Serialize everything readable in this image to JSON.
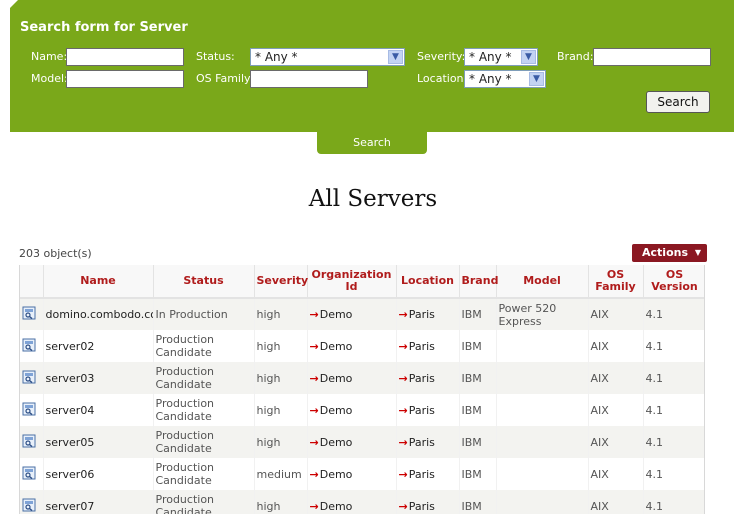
{
  "search_form": {
    "title": "Search form for Server",
    "labels": {
      "name": "Name:",
      "status": "Status:",
      "severity": "Severity:",
      "brand": "Brand:",
      "model": "Model:",
      "os_family": "OS Family:",
      "location": "Location:"
    },
    "values": {
      "name": "",
      "status": "* Any *",
      "severity": "* Any *",
      "brand": "",
      "model": "",
      "os_family": "",
      "location": "* Any *"
    },
    "search_button": "Search",
    "search_tab": "Search"
  },
  "page": {
    "title": "All Servers",
    "object_count": "203 object(s)",
    "actions_label": "Actions"
  },
  "table": {
    "columns": [
      "",
      "Name",
      "Status",
      "Severity",
      "Organization Id",
      "Location",
      "Brand",
      "Model",
      "OS Family",
      "OS Version"
    ],
    "rows": [
      {
        "name": "domino.combodo.com",
        "status": "In Production",
        "severity": "high",
        "org": "Demo",
        "location": "Paris",
        "brand": "IBM",
        "model": "Power 520 Express",
        "os_family": "AIX",
        "os_version": "4.1"
      },
      {
        "name": "server02",
        "status": "Production Candidate",
        "severity": "high",
        "org": "Demo",
        "location": "Paris",
        "brand": "IBM",
        "model": "",
        "os_family": "AIX",
        "os_version": "4.1"
      },
      {
        "name": "server03",
        "status": "Production Candidate",
        "severity": "high",
        "org": "Demo",
        "location": "Paris",
        "brand": "IBM",
        "model": "",
        "os_family": "AIX",
        "os_version": "4.1"
      },
      {
        "name": "server04",
        "status": "Production Candidate",
        "severity": "high",
        "org": "Demo",
        "location": "Paris",
        "brand": "IBM",
        "model": "",
        "os_family": "AIX",
        "os_version": "4.1"
      },
      {
        "name": "server05",
        "status": "Production Candidate",
        "severity": "high",
        "org": "Demo",
        "location": "Paris",
        "brand": "IBM",
        "model": "",
        "os_family": "AIX",
        "os_version": "4.1"
      },
      {
        "name": "server06",
        "status": "Production Candidate",
        "severity": "medium",
        "org": "Demo",
        "location": "Paris",
        "brand": "IBM",
        "model": "",
        "os_family": "AIX",
        "os_version": "4.1"
      },
      {
        "name": "server07",
        "status": "Production Candidate",
        "severity": "high",
        "org": "Demo",
        "location": "Paris",
        "brand": "IBM",
        "model": "",
        "os_family": "AIX",
        "os_version": "4.1"
      }
    ]
  },
  "icons": {
    "row_icon": "server-details-icon",
    "link_arrow": "external-link-arrow-icon",
    "dropdown": "chevron-down-icon"
  },
  "colors": {
    "panel_green": "#7aa81a",
    "header_red": "#b01c1c",
    "actions_maroon": "#8b1822",
    "link_arrow_red": "#cc0000"
  }
}
